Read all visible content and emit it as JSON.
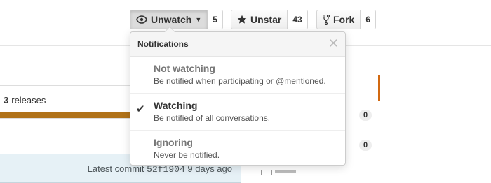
{
  "actions": {
    "watch": {
      "label": "Unwatch",
      "count": "5",
      "icon": "eye-icon"
    },
    "star": {
      "label": "Unstar",
      "count": "43",
      "icon": "star-icon"
    },
    "fork": {
      "label": "Fork",
      "count": "6",
      "icon": "fork-icon"
    }
  },
  "notifications": {
    "title": "Notifications",
    "options": [
      {
        "name": "Not watching",
        "description": "Be notified when participating or @mentioned.",
        "selected": false
      },
      {
        "name": "Watching",
        "description": "Be notified of all conversations.",
        "selected": true
      },
      {
        "name": "Ignoring",
        "description": "Never be notified.",
        "selected": false
      }
    ]
  },
  "repo": {
    "releases_count": "3",
    "releases_label": "releases",
    "language_color": "#b07219",
    "latest_commit_label": "Latest commit",
    "latest_commit_sha": "52f1904",
    "latest_commit_age": "9 days ago"
  },
  "side_badges": [
    "0",
    "0"
  ]
}
